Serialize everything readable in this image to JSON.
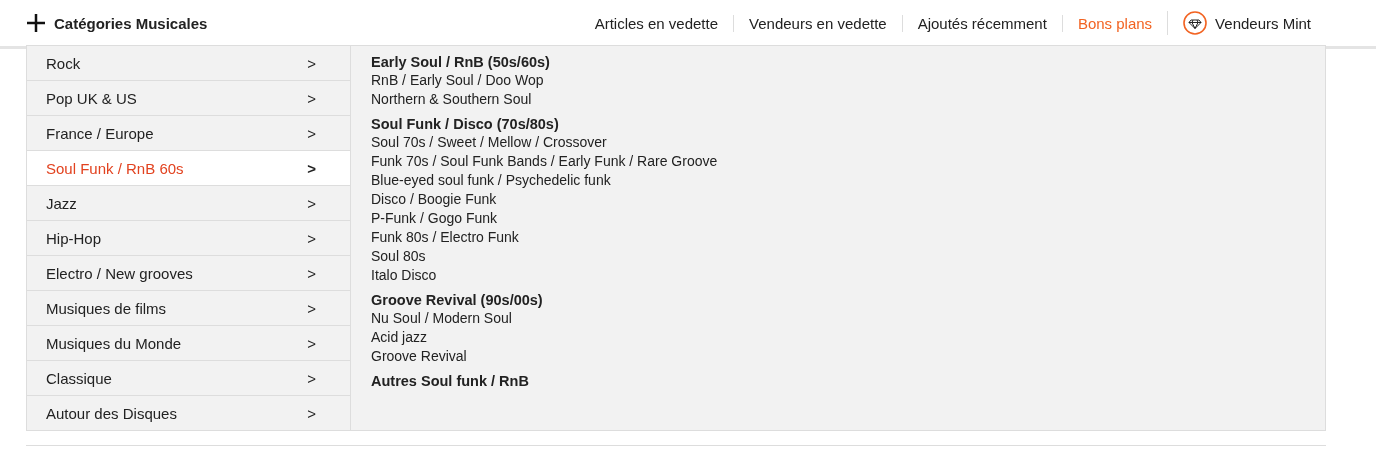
{
  "header": {
    "title": "Catégories Musicales"
  },
  "nav": [
    {
      "label": "Articles en vedette",
      "kind": "link"
    },
    {
      "label": "Vendeurs en vedette",
      "kind": "link"
    },
    {
      "label": "Ajoutés récemment",
      "kind": "link"
    },
    {
      "label": "Bons plans",
      "kind": "promo"
    },
    {
      "label": "Vendeurs Mint",
      "kind": "mint"
    }
  ],
  "categories": [
    {
      "label": "Rock",
      "arrow": ">",
      "selected": false
    },
    {
      "label": "Pop UK & US",
      "arrow": ">",
      "selected": false
    },
    {
      "label": "France / Europe",
      "arrow": ">",
      "selected": false
    },
    {
      "label": "Soul Funk / RnB 60s",
      "arrow": ">",
      "selected": true
    },
    {
      "label": "Jazz",
      "arrow": ">",
      "selected": false
    },
    {
      "label": "Hip-Hop",
      "arrow": ">",
      "selected": false
    },
    {
      "label": "Electro / New grooves",
      "arrow": ">",
      "selected": false
    },
    {
      "label": "Musiques de films",
      "arrow": ">",
      "selected": false
    },
    {
      "label": "Musiques du Monde",
      "arrow": ">",
      "selected": false
    },
    {
      "label": "Classique",
      "arrow": ">",
      "selected": false
    },
    {
      "label": "Autour des Disques",
      "arrow": ">",
      "selected": false
    }
  ],
  "subcategories": [
    {
      "heading": "Early Soul / RnB (50s/60s)",
      "items": [
        "RnB / Early Soul / Doo Wop",
        "Northern & Southern Soul"
      ]
    },
    {
      "heading": "Soul Funk / Disco (70s/80s)",
      "items": [
        "Soul 70s / Sweet / Mellow / Crossover",
        "Funk 70s / Soul Funk Bands / Early Funk / Rare Groove",
        "Blue-eyed soul funk / Psychedelic funk",
        "Disco / Boogie Funk",
        "P-Funk / Gogo Funk",
        "Funk 80s / Electro Funk",
        "Soul 80s",
        "Italo Disco"
      ]
    },
    {
      "heading": "Groove Revival (90s/00s)",
      "items": [
        "Nu Soul / Modern Soul",
        "Acid jazz",
        "Groove Revival"
      ]
    },
    {
      "heading": "Autres Soul funk / RnB"
    }
  ]
}
